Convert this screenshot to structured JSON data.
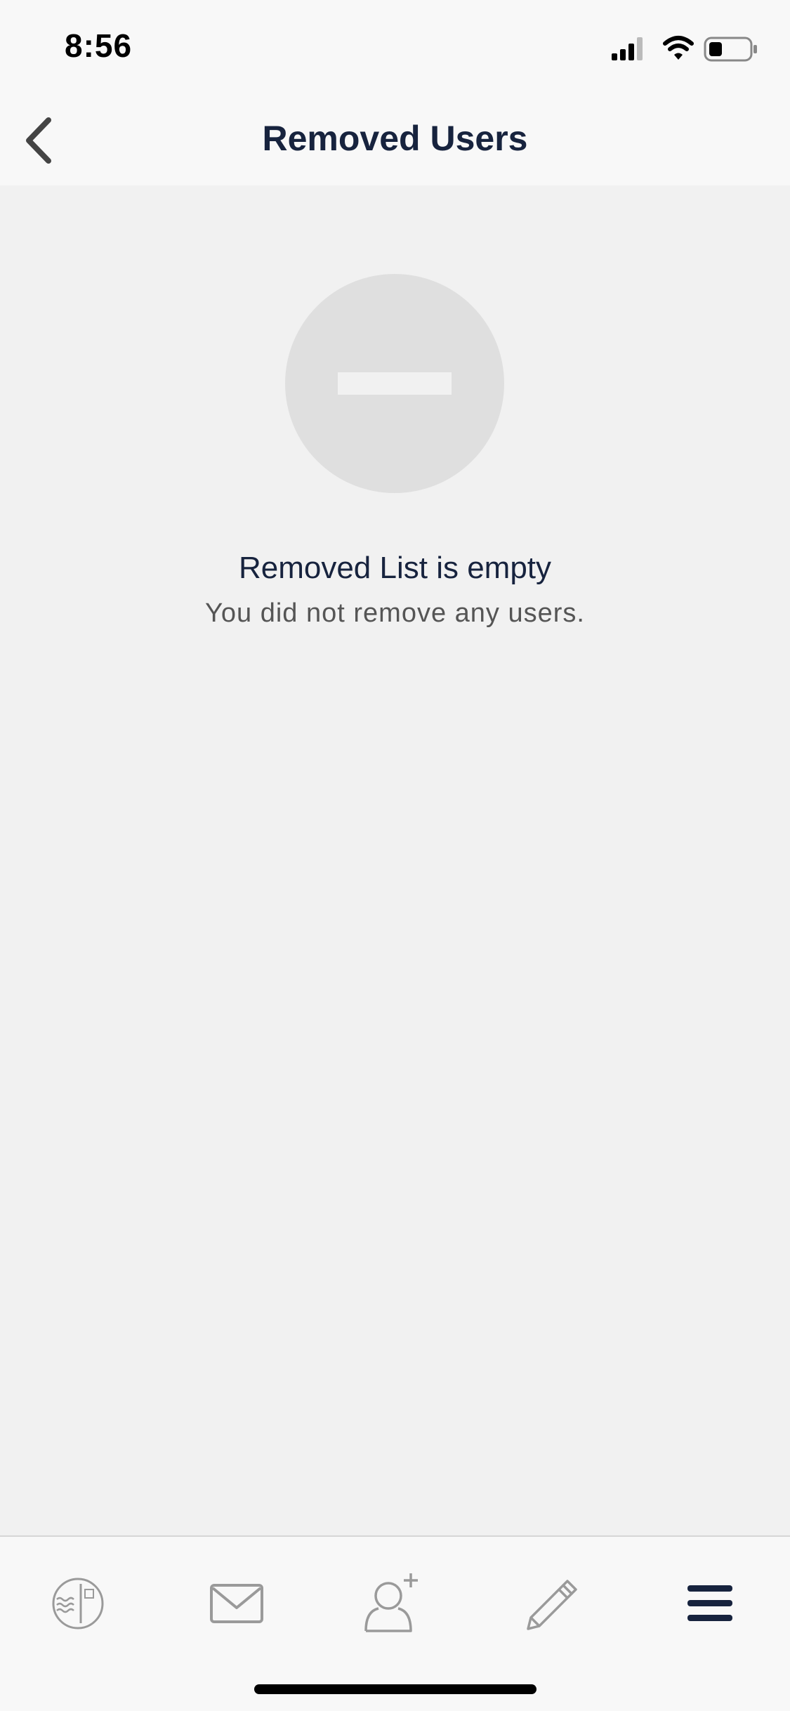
{
  "status_bar": {
    "time": "8:56"
  },
  "nav": {
    "title": "Removed Users"
  },
  "empty_state": {
    "title": "Removed List is empty",
    "subtitle": "You did not remove any users."
  },
  "tab_bar": {
    "items": [
      {
        "icon": "golf-scorecard-icon"
      },
      {
        "icon": "mail-icon"
      },
      {
        "icon": "add-user-icon"
      },
      {
        "icon": "pencil-icon"
      },
      {
        "icon": "menu-icon"
      }
    ]
  },
  "colors": {
    "title": "#17233e",
    "icon_gray": "#9a9a9a",
    "active_icon": "#17233e",
    "background": "#f1f1f1",
    "bar_background": "#f8f8f8"
  }
}
